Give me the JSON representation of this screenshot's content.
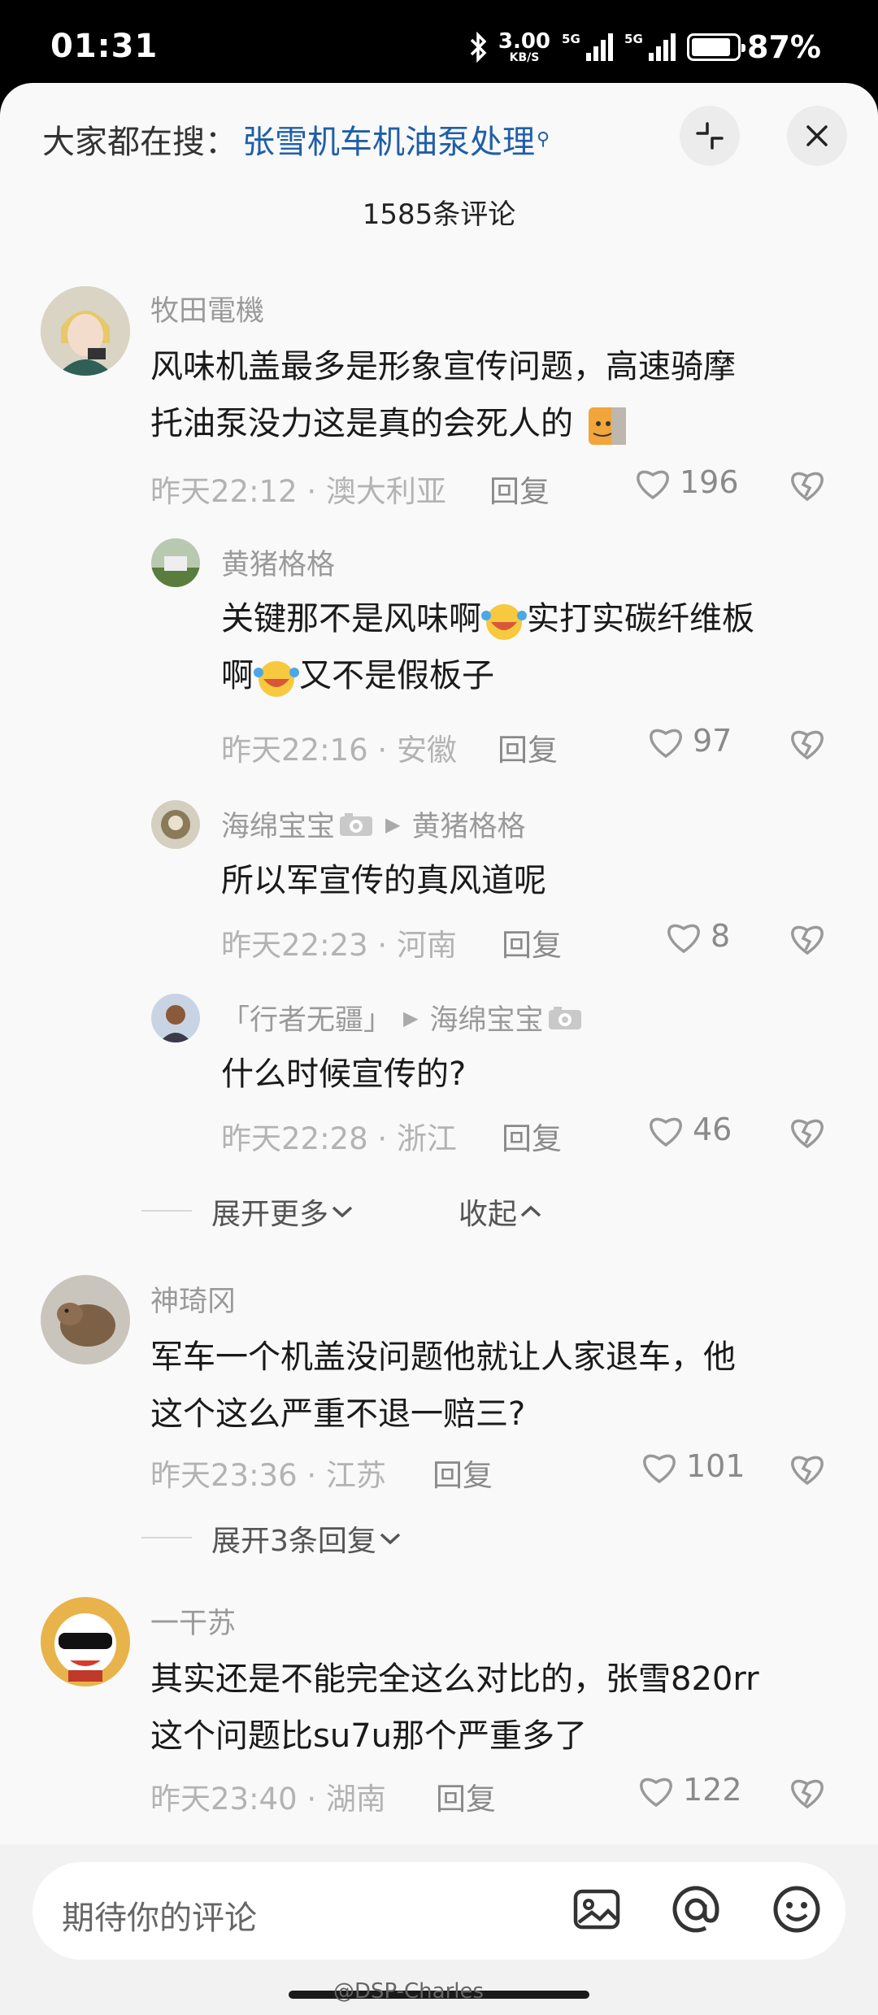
{
  "status_bar": {
    "time": "01:31",
    "net_speed": "3.00",
    "net_unit": "KB/S",
    "sim1": "5G",
    "sim2": "5G",
    "battery": "87%",
    "battery_level": 0.87
  },
  "header": {
    "search_prefix": "大家都在搜：",
    "search_keyword": "张雪机车机油泵处理",
    "comment_count": "1585条评论"
  },
  "comments": [
    {
      "name": "牧田電機",
      "text_a": "风味机盖最多是形象宣传问题，高速骑摩",
      "text_b": "托油泵没力这是真的会死人的",
      "time": "昨天22:12",
      "location": "澳大利亚",
      "reply": "回复",
      "likes": "196"
    },
    {
      "name": "黄猪格格",
      "text_a": "关键那不是风味啊",
      "text_b": "实打实碳纤维板",
      "text_c": "啊",
      "text_d": "又不是假板子",
      "time": "昨天22:16",
      "location": "安徽",
      "reply": "回复",
      "likes": "97"
    },
    {
      "name": "海绵宝宝",
      "reply_to": "黄猪格格",
      "text_a": "所以军宣传的真风道呢",
      "time": "昨天22:23",
      "location": "河南",
      "reply": "回复",
      "likes": "8"
    },
    {
      "name": "「行者无疆」",
      "reply_to": "海绵宝宝",
      "text_a": "什么时候宣传的?",
      "time": "昨天22:28",
      "location": "浙江",
      "reply": "回复",
      "likes": "46"
    },
    {
      "name": "神琦冈",
      "text_a": "军车一个机盖没问题他就让人家退车，他",
      "text_b": "这个这么严重不退一赔三?",
      "time": "昨天23:36",
      "location": "江苏",
      "reply": "回复",
      "likes": "101"
    },
    {
      "name": "一干苏",
      "text_a": "其实还是不能完全这么对比的，张雪820rr",
      "text_b": "这个问题比su7u那个严重多了",
      "time": "昨天23:40",
      "location": "湖南",
      "reply": "回复",
      "likes": "122"
    }
  ],
  "expand": {
    "more": "展开更多",
    "collapse": "收起",
    "more_replies": "展开3条回复"
  },
  "input": {
    "placeholder": "期待你的评论"
  },
  "watermark": "@DSP-Charles",
  "colors": {
    "keyword": "#1f5fa8",
    "sheet": "#f9f9f9",
    "muted": "#b3b3b3"
  }
}
